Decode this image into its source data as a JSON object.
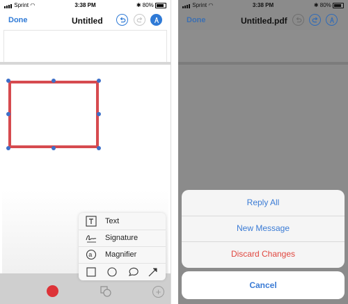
{
  "left": {
    "status": {
      "carrier": "Sprint",
      "time": "3:38 PM",
      "battery": "80%"
    },
    "nav": {
      "done": "Done",
      "title": "Untitled"
    },
    "popup": {
      "items": [
        {
          "label": "Text",
          "icon": "text-box-icon"
        },
        {
          "label": "Signature",
          "icon": "signature-icon"
        },
        {
          "label": "Magnifier",
          "icon": "magnifier-icon"
        }
      ],
      "shapes": [
        "square-icon",
        "circle-icon",
        "speech-bubble-icon",
        "arrow-icon"
      ]
    },
    "toolbar": {
      "color_selected": "#dd3338"
    }
  },
  "right": {
    "status": {
      "carrier": "Sprint",
      "time": "3:38 PM",
      "battery": "80%"
    },
    "nav": {
      "done": "Done",
      "title": "Untitled.pdf"
    },
    "sheet": {
      "options": [
        "Reply All",
        "New Message",
        "Discard Changes"
      ],
      "cancel": "Cancel"
    }
  },
  "colors": {
    "accent": "#2f7ad6",
    "danger": "#e0463e",
    "annotation": "#d64a4f"
  }
}
